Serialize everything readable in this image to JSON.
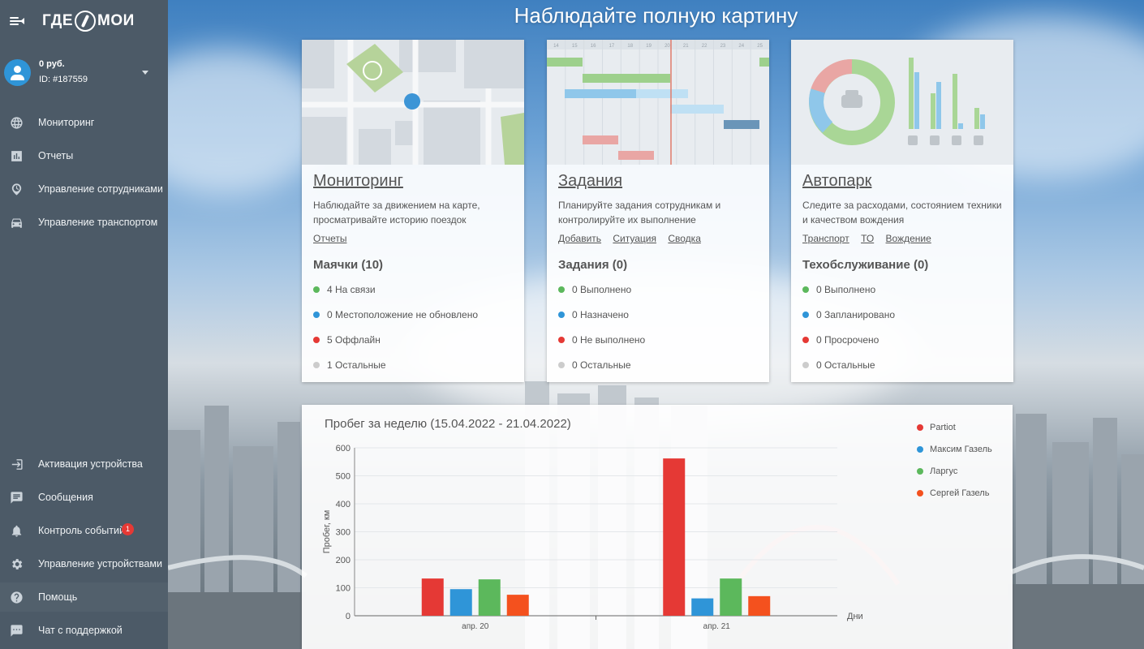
{
  "brand": {
    "logo_left": "ГДЕ",
    "logo_right": "МОИ"
  },
  "account": {
    "balance": "0 руб.",
    "id": "ID: #187559"
  },
  "nav_top": [
    {
      "label": "Мониторинг",
      "icon": "globe-icon"
    },
    {
      "label": "Отчеты",
      "icon": "bar-chart-icon"
    },
    {
      "label": "Управление сотрудниками",
      "icon": "clock-pin-icon"
    },
    {
      "label": "Управление транспортом",
      "icon": "car-icon"
    }
  ],
  "nav_bottom": [
    {
      "label": "Активация устройства",
      "icon": "login-icon"
    },
    {
      "label": "Сообщения",
      "icon": "message-icon"
    },
    {
      "label": "Контроль событий",
      "icon": "bell-icon",
      "badge": "1"
    },
    {
      "label": "Управление устройствами",
      "icon": "gear-icon"
    },
    {
      "label": "Помощь",
      "icon": "help-icon"
    },
    {
      "label": "Чат с поддержкой",
      "icon": "chat-icon"
    }
  ],
  "page_title": "Наблюдайте полную картину",
  "cards": [
    {
      "title": "Мониторинг",
      "desc": "Наблюдайте за движением на карте, просматривайте историю поездок",
      "links": [
        "Отчеты"
      ],
      "sub": "Маячки (10)",
      "stats": [
        {
          "text": "4 На связи",
          "color": "#5cb85c"
        },
        {
          "text": "0 Местоположение не обновлено",
          "color": "#2f95d8"
        },
        {
          "text": "5 Оффлайн",
          "color": "#e53935"
        },
        {
          "text": "1 Остальные",
          "color": "#cccccc"
        }
      ]
    },
    {
      "title": "Задания",
      "desc": "Планируйте задания сотрудникам и контролируйте их выполнение",
      "links": [
        "Добавить",
        "Ситуация",
        "Сводка"
      ],
      "sub": "Задания (0)",
      "stats": [
        {
          "text": "0 Выполнено",
          "color": "#5cb85c"
        },
        {
          "text": "0 Назначено",
          "color": "#2f95d8"
        },
        {
          "text": "0 Не выполнено",
          "color": "#e53935"
        },
        {
          "text": "0 Остальные",
          "color": "#cccccc"
        }
      ]
    },
    {
      "title": "Автопарк",
      "desc": "Следите за расходами, состоянием техники и качеством вождения",
      "links": [
        "Транспорт",
        "ТО",
        "Вождение"
      ],
      "sub": "Техобслуживание (0)",
      "stats": [
        {
          "text": "0 Выполнено",
          "color": "#5cb85c"
        },
        {
          "text": "0 Запланировано",
          "color": "#2f95d8"
        },
        {
          "text": "0 Просрочено",
          "color": "#e53935"
        },
        {
          "text": "0 Остальные",
          "color": "#cccccc"
        }
      ]
    }
  ],
  "gantt_ticks": [
    "14",
    "15",
    "16",
    "17",
    "18",
    "19",
    "20",
    "21",
    "22",
    "23",
    "24",
    "25"
  ],
  "chart_data": {
    "type": "bar",
    "title": "Пробег за неделю (15.04.2022 - 21.04.2022)",
    "xlabel": "Дни",
    "ylabel": "Пробег, км",
    "categories": [
      "апр. 20",
      "апр. 21"
    ],
    "ylim": [
      0,
      600
    ],
    "yticks": [
      0,
      100,
      200,
      300,
      400,
      500,
      600
    ],
    "legend_position": "top-right",
    "series": [
      {
        "name": "Partiot",
        "color": "#e53935",
        "values": [
          133,
          562
        ]
      },
      {
        "name": "Максим Газель",
        "color": "#2f95d8",
        "values": [
          95,
          62
        ]
      },
      {
        "name": "Ларгус",
        "color": "#5cb85c",
        "values": [
          130,
          133
        ]
      },
      {
        "name": "Сергей Газель",
        "color": "#f4511e",
        "values": [
          75,
          70
        ]
      }
    ]
  }
}
